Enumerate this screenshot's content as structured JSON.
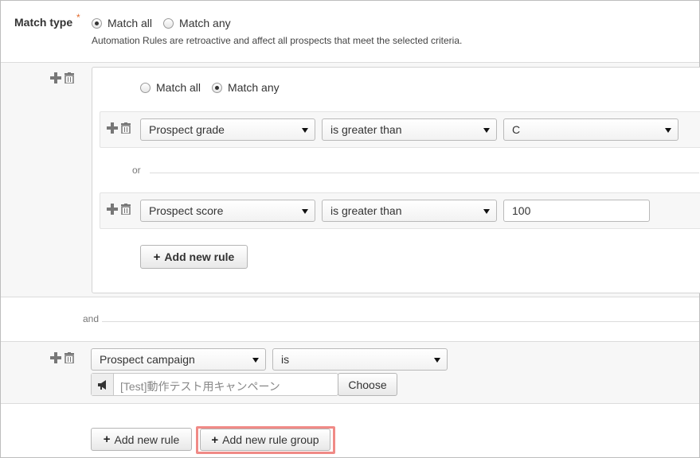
{
  "match_type": {
    "label": "Match type",
    "required_mark": "*",
    "options": [
      "Match all",
      "Match any"
    ],
    "selected": "Match all",
    "help_text": "Automation Rules are retroactive and affect all prospects that meet the selected criteria."
  },
  "rule_group": {
    "match_options": [
      "Match all",
      "Match any"
    ],
    "selected": "Match any",
    "rules": [
      {
        "field": "Prospect grade",
        "operator": "is greater than",
        "value": "C",
        "value_type": "select"
      },
      {
        "field": "Prospect score",
        "operator": "is greater than",
        "value": "100",
        "value_type": "input"
      }
    ],
    "or_label": "or",
    "add_rule_label": "Add new rule"
  },
  "and_label": "and",
  "campaign_rule": {
    "field": "Prospect campaign",
    "operator": "is",
    "campaign_value": "[Test]動作テスト用キャンペーン",
    "choose_label": "Choose"
  },
  "footer": {
    "add_rule_label": "Add new rule",
    "add_group_label": "Add new rule group"
  },
  "colors": {
    "highlight": "#f08a86",
    "required": "#e26a2c"
  }
}
